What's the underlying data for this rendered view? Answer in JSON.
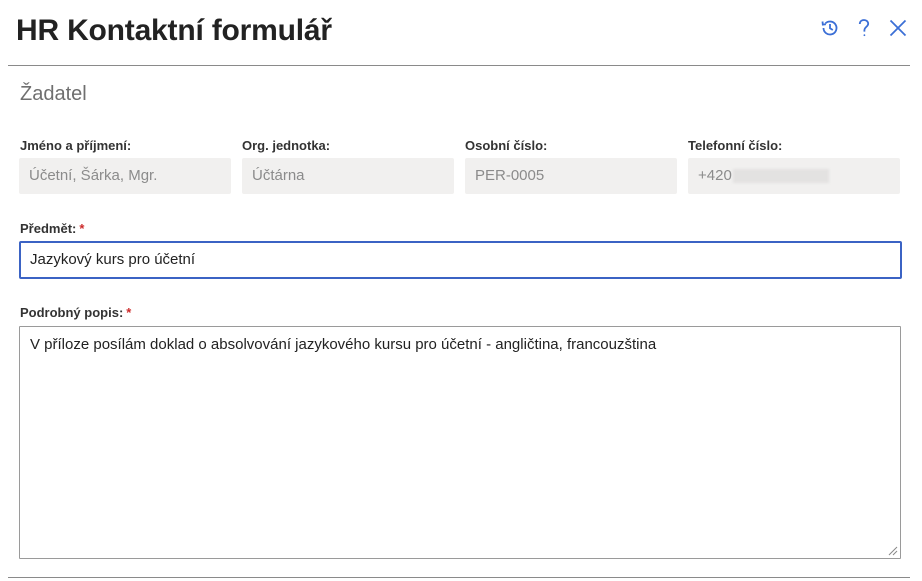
{
  "header": {
    "title": "HR Kontaktní formulář",
    "icons": [
      "history-icon",
      "help-icon",
      "close-icon"
    ],
    "accent_color": "#3b6fd6"
  },
  "section": {
    "title": "Žadatel"
  },
  "applicant": {
    "name_label": "Jméno a příjmení:",
    "name_value": "Účetní, Šárka, Mgr.",
    "org_label": "Org. jednotka:",
    "org_value": "Účtárna",
    "personal_no_label": "Osobní číslo:",
    "personal_no_value": "PER-0005",
    "phone_label": "Telefonní číslo:",
    "phone_value": "+420"
  },
  "subject": {
    "label": "Předmět:",
    "required_mark": "*",
    "value": "Jazykový kurs pro účetní"
  },
  "description": {
    "label": "Podrobný popis:",
    "required_mark": "*",
    "value": "V příloze posílám doklad o absolvování jazykového kursu pro účetní - angličtina, francouzština"
  }
}
